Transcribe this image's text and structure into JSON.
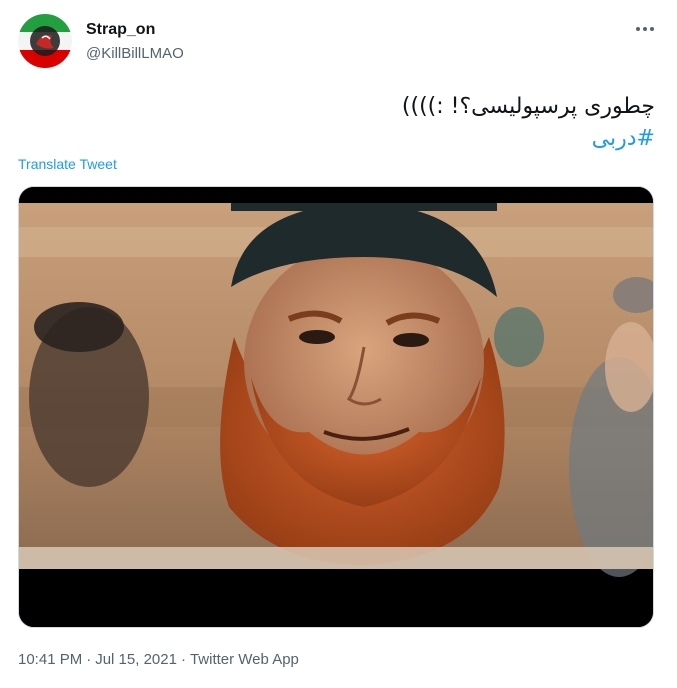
{
  "user": {
    "display_name": "Strap_on",
    "handle": "@KillBillLMAO"
  },
  "tweet": {
    "text": "چطوری پرسپولیسی؟! :))))",
    "hashtag": "#دربی",
    "translate_label": "Translate Tweet",
    "more_icon": "more-horizontal-icon"
  },
  "meta": {
    "time": "10:41 PM",
    "separator": "·",
    "date": "Jul 15, 2021",
    "source": "Twitter Web App"
  },
  "colors": {
    "link": "#1d9bf0",
    "secondary_text": "#536471",
    "primary_text": "#0f1419"
  }
}
